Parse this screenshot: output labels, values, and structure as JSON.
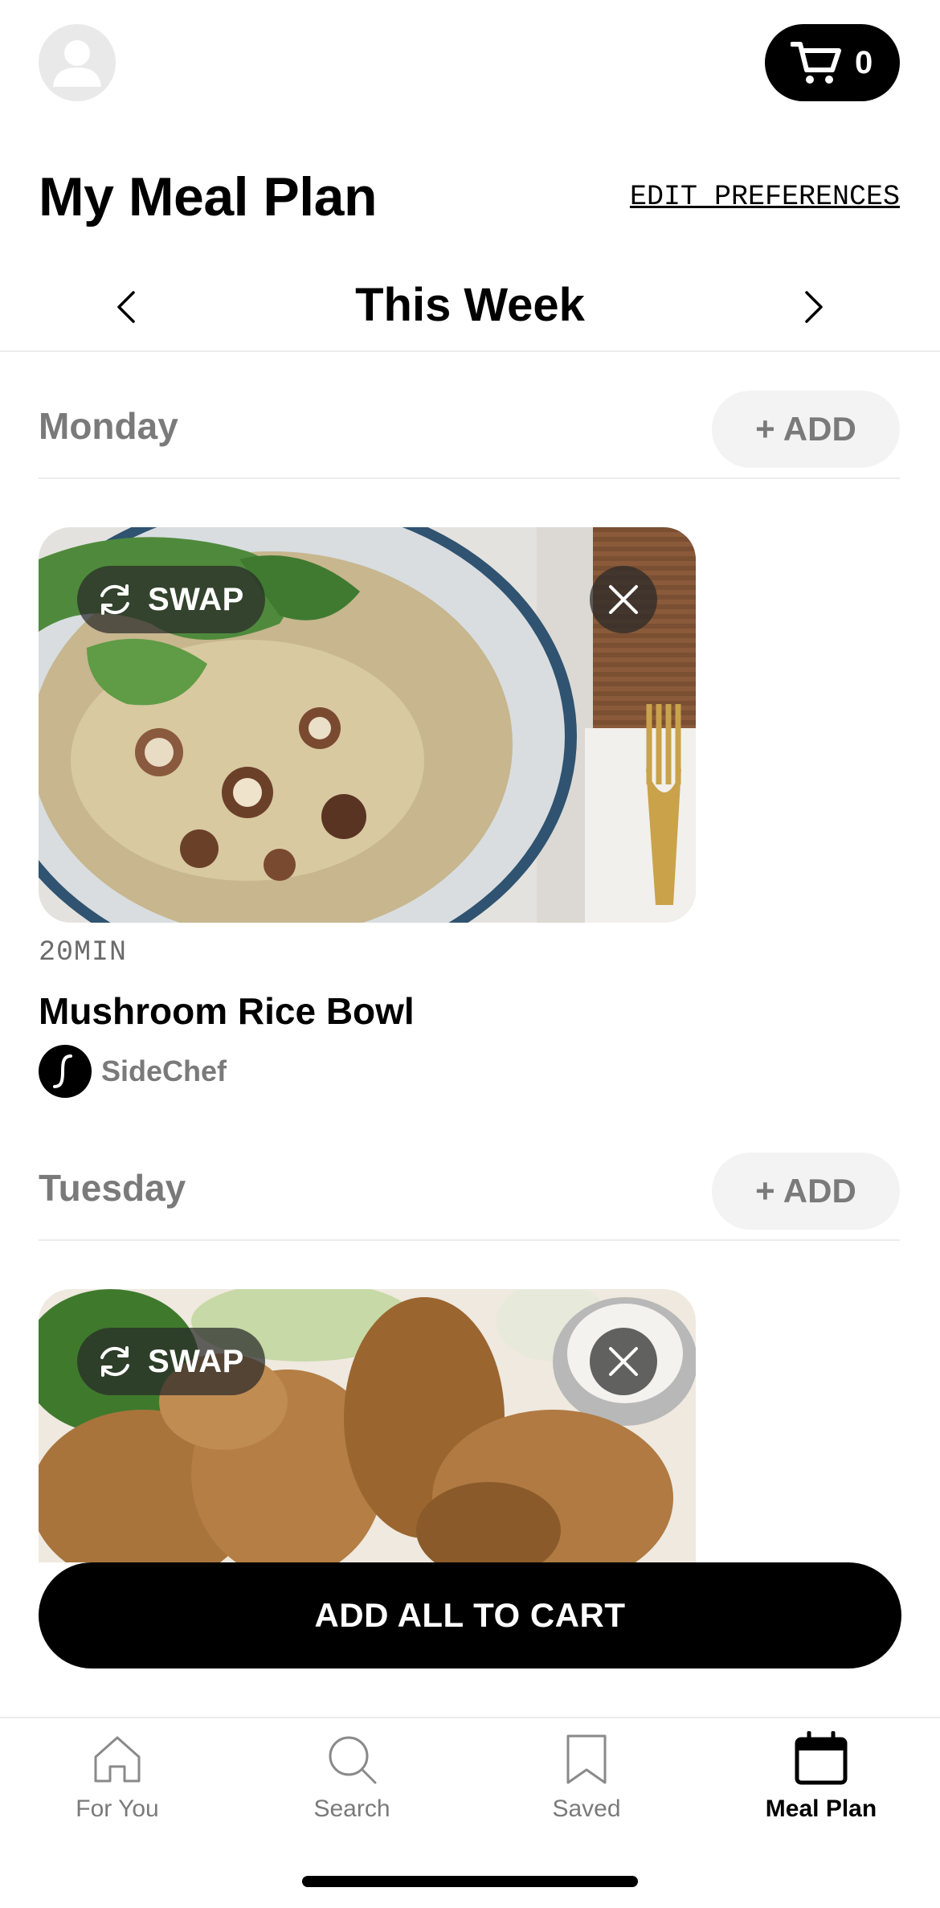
{
  "header": {
    "avatar_icon": "user-avatar-icon",
    "cart_icon": "cart-icon",
    "cart_count": "0"
  },
  "page": {
    "title": "My Meal Plan",
    "edit_preferences": "EDIT PREFERENCES"
  },
  "week": {
    "label": "This Week",
    "prev_icon": "chevron-left-icon",
    "next_icon": "chevron-right-icon"
  },
  "days": [
    {
      "name": "Monday",
      "add_label": "+ ADD",
      "recipe": {
        "swap_label": "SWAP",
        "time": "20MIN",
        "title": "Mushroom Rice Bowl",
        "author": "SideChef"
      }
    },
    {
      "name": "Tuesday",
      "add_label": "+ ADD",
      "recipe": {
        "swap_label": "SWAP"
      }
    }
  ],
  "actions": {
    "add_all_to_cart": "ADD ALL TO CART"
  },
  "bottom_nav": {
    "items": [
      {
        "label": "For You",
        "icon": "home-icon",
        "active": false
      },
      {
        "label": "Search",
        "icon": "search-icon",
        "active": false
      },
      {
        "label": "Saved",
        "icon": "bookmark-icon",
        "active": false
      },
      {
        "label": "Meal Plan",
        "icon": "calendar-icon",
        "active": true
      }
    ]
  },
  "colors": {
    "primary": "#000000",
    "muted_text": "#7a7a7a",
    "chip_bg": "#f3f3f3",
    "divider": "#ececec"
  }
}
